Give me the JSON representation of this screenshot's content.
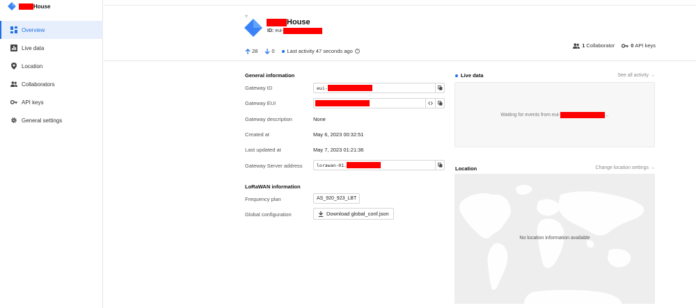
{
  "sidebar": {
    "brand_suffix": "House",
    "items": [
      {
        "label": "Overview",
        "icon": "dashboard-icon",
        "active": true
      },
      {
        "label": "Live data",
        "icon": "chart-icon"
      },
      {
        "label": "Location",
        "icon": "location-pin-icon"
      },
      {
        "label": "Collaborators",
        "icon": "people-icon"
      },
      {
        "label": "API keys",
        "icon": "key-icon"
      },
      {
        "label": "General settings",
        "icon": "gear-icon"
      }
    ]
  },
  "header": {
    "title_suffix": "House",
    "id_label": "ID:",
    "id_prefix": "eui-",
    "uplinks": "28",
    "downlinks": "0",
    "last_activity": "Last activity 47 seconds ago",
    "collaborators_count": "1",
    "collaborators_label": "Collaborator",
    "api_keys_count": "0",
    "api_keys_label": "API keys"
  },
  "general": {
    "title": "General information",
    "gateway_id_label": "Gateway ID",
    "gateway_id_prefix": "eui-",
    "gateway_eui_label": "Gateway EUI",
    "description_label": "Gateway description",
    "description_value": "None",
    "created_label": "Created at",
    "created_value": "May 6, 2023 00:32:51",
    "updated_label": "Last updated at",
    "updated_value": "May 7, 2023 01:21:36",
    "server_label": "Gateway Server address",
    "server_prefix": "lorawan-01."
  },
  "lorawan": {
    "title": "LoRaWAN information",
    "freq_label": "Frequency plan",
    "freq_value": "AS_920_923_LBT",
    "global_label": "Global configuration",
    "download_label": "Download global_conf.json"
  },
  "live": {
    "title": "Live data",
    "link": "See all activity →",
    "waiting_prefix": "Waiting for events from eui-",
    "waiting_suffix": "..."
  },
  "location": {
    "title": "Location",
    "link": "Change location settings →",
    "message": "No location information available"
  },
  "colors": {
    "accent": "#1f6fe5",
    "redaction": "#ff0000"
  }
}
